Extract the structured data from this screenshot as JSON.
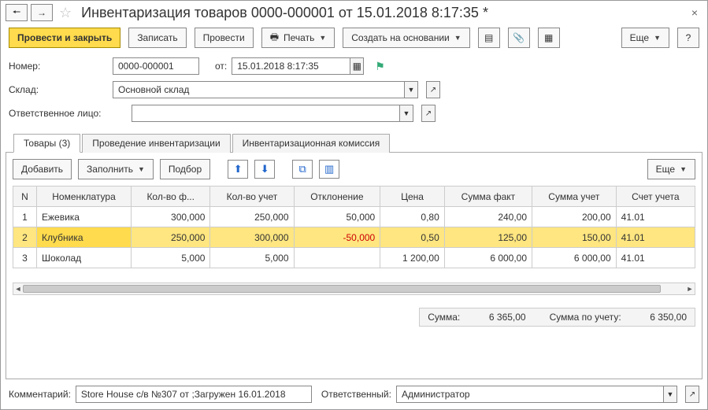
{
  "nav": {
    "back": "🠔",
    "fwd": "→"
  },
  "title": "Инвентаризация товаров 0000-000001 от 15.01.2018 8:17:35 *",
  "toolbar": {
    "post_close": "Провести и закрыть",
    "save": "Записать",
    "post": "Провести",
    "print": "Печать",
    "create_based": "Создать на основании",
    "more": "Еще",
    "help": "?"
  },
  "form": {
    "number_label": "Номер:",
    "number": "0000-000001",
    "from_label": "от:",
    "date": "15.01.2018  8:17:35",
    "warehouse_label": "Склад:",
    "warehouse": "Основной склад",
    "responsible_label": "Ответственное лицо:",
    "responsible": ""
  },
  "tabs": {
    "t1": "Товары (3)",
    "t2": "Проведение инвентаризации",
    "t3": "Инвентаризационная комиссия"
  },
  "tabtoolbar": {
    "add": "Добавить",
    "fill": "Заполнить",
    "pick": "Подбор",
    "more": "Еще"
  },
  "cols": {
    "n": "N",
    "nom": "Номенклатура",
    "qf": "Кол-во ф...",
    "qu": "Кол-во учет",
    "dev": "Отклонение",
    "price": "Цена",
    "sf": "Сумма факт",
    "su": "Сумма учет",
    "acc": "Счет учета"
  },
  "rows": [
    {
      "n": "1",
      "nom": "Ежевика",
      "qf": "300,000",
      "qu": "250,000",
      "dev": "50,000",
      "price": "0,80",
      "sf": "240,00",
      "su": "200,00",
      "acc": "41.01",
      "sel": false,
      "neg": false
    },
    {
      "n": "2",
      "nom": "Клубника",
      "qf": "250,000",
      "qu": "300,000",
      "dev": "-50,000",
      "price": "0,50",
      "sf": "125,00",
      "su": "150,00",
      "acc": "41.01",
      "sel": true,
      "neg": true
    },
    {
      "n": "3",
      "nom": "Шоколад",
      "qf": "5,000",
      "qu": "5,000",
      "dev": "",
      "price": "1 200,00",
      "sf": "6 000,00",
      "su": "6 000,00",
      "acc": "41.01",
      "sel": false,
      "neg": false
    }
  ],
  "totals": {
    "sum_label": "Сумма:",
    "sum": "6 365,00",
    "sumacc_label": "Сумма по учету:",
    "sumacc": "6 350,00"
  },
  "footer": {
    "comment_label": "Комментарий:",
    "comment": "Store House с/в №307 от ;Загружен 16.01.2018",
    "resp_label": "Ответственный:",
    "resp": "Администратор"
  }
}
